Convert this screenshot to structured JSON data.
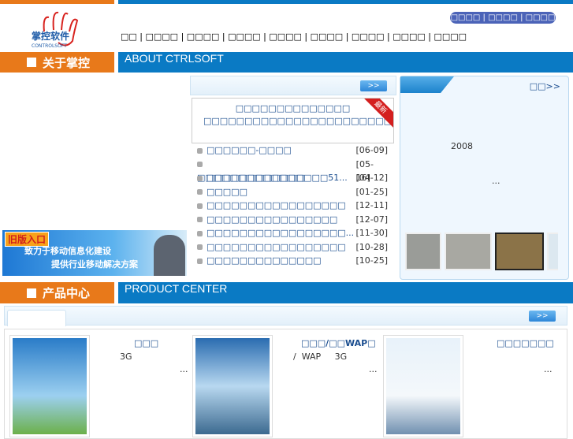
{
  "logo": {
    "text": "掌控软件",
    "sub": "CONTROLSOFT"
  },
  "top_links": [
    "□□□□",
    "□□□□",
    "□□□□",
    "□□□□"
  ],
  "nav": [
    "□□",
    "□□□□",
    "□□□□",
    "□□□□",
    "□□□□",
    "□□□□",
    "□□□□",
    "□□□□",
    "□□□□"
  ],
  "about": {
    "cn": "关于掌控",
    "en": "ABOUT CTRLSOFT"
  },
  "news": {
    "more": ">>",
    "ribbon": "最新",
    "featured_title": "□□□□□□□□□□□□□□",
    "featured_text": "□□□□□□□□□□□□□□□□□□□□□□□□□□□□□□□□□□□□□□□□□□□□□□...",
    "items": [
      {
        "t": "□□□□□□-□□□□",
        "d": "[06-09]"
      },
      {
        "t": "□□□□□□□□□□□□□□□□51...",
        "d": "[05-16]"
      },
      {
        "t": "□□□□□□□□□□□□",
        "d": "[04-12]"
      },
      {
        "t": "□□□□□",
        "d": "[01-25]"
      },
      {
        "t": "□□□□□□□□□□□□□□□□□",
        "d": "[12-11]"
      },
      {
        "t": "□□□□□□□□□□□□□□□□",
        "d": "[12-07]"
      },
      {
        "t": "□□□□□□□□□□□□□□□□□...",
        "d": "[11-30]"
      },
      {
        "t": "□□□□□□□□□□□□□□□□□",
        "d": "[10-28]"
      },
      {
        "t": "□□□□□□□□□□□□□□",
        "d": "[10-25]"
      }
    ]
  },
  "honor": {
    "more": "□□>>",
    "year": "2008",
    "ellipsis": "..."
  },
  "banner": {
    "badge": "旧版入口",
    "line1": "致力于移动信息化建设",
    "line2": "提供行业移动解决方案"
  },
  "products": {
    "cn": "产品中心",
    "en": "PRODUCT CENTER",
    "more": ">>",
    "items": [
      {
        "title": "□□□",
        "desc": "3G",
        "more": "..."
      },
      {
        "title": "□□□/□□WAP□",
        "desc": "/  WAP     3G",
        "more": "..."
      },
      {
        "title": "□□□□□□□",
        "desc": "",
        "more": "..."
      }
    ]
  }
}
